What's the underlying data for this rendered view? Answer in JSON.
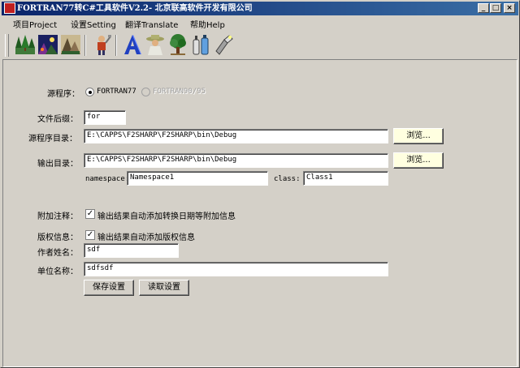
{
  "window": {
    "title": "FORTRAN77转C#工具软件V2.2- 北京联高软件开发有限公司",
    "controls": {
      "minimize": "_",
      "maximize": "□",
      "close": "×"
    }
  },
  "menu": [
    {
      "label": "项目Project"
    },
    {
      "label": "设置Setting"
    },
    {
      "label": "翻译Translate"
    },
    {
      "label": "帮助Help"
    }
  ],
  "toolbar": {
    "buttons": [
      {
        "icon": "trees-icon"
      },
      {
        "icon": "night-scene-icon"
      },
      {
        "icon": "landscape-icon"
      },
      {
        "icon": "worker-icon"
      },
      {
        "icon": "letter-a-icon"
      },
      {
        "icon": "hat-person-icon"
      },
      {
        "icon": "tree-icon"
      },
      {
        "icon": "bottles-icon"
      },
      {
        "icon": "flashlight-icon"
      }
    ]
  },
  "form": {
    "source_label": "源程序：",
    "source_options": [
      {
        "label": "FORTRAN77",
        "selected": true,
        "enabled": true
      },
      {
        "label": "FORTRAN90/95",
        "selected": false,
        "enabled": false
      }
    ],
    "suffix_label": "文件后缀：",
    "suffix_value": "for",
    "source_dir_label": "源程序目录：",
    "source_dir_value": "E:\\CAPPS\\F2SHARP\\F2SHARP\\bin\\Debug",
    "browse_label": "浏览...",
    "output_dir_label": "输出目录：",
    "output_dir_value": "E:\\CAPPS\\F2SHARP\\F2SHARP\\bin\\Debug",
    "namespace_label": "namespace:",
    "namespace_value": "Namespace1",
    "class_label": "class:",
    "class_value": "Class1",
    "comment_label": "附加注释：",
    "comment_check_label": "输出结果自动添加转换日期等附加信息",
    "comment_checked": true,
    "copyright_label": "版权信息：",
    "copyright_check_label": "输出结果自动添加版权信息",
    "copyright_checked": true,
    "author_label": "作者姓名：",
    "author_value": "sdf",
    "company_label": "单位名称：",
    "company_value": "sdfsdf",
    "save_label": "保存设置",
    "load_label": "读取设置"
  },
  "colors": {
    "titlebar_start": "#0a246a",
    "titlebar_end": "#3a6ea5",
    "face": "#d4d0c8",
    "browse_button": "#ffffe0"
  }
}
